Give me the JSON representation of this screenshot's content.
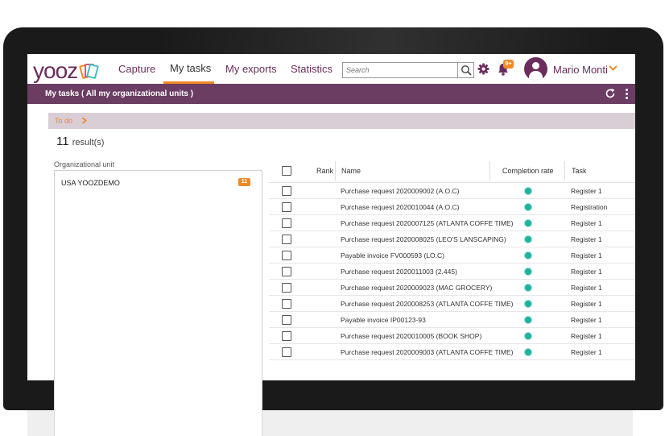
{
  "app": {
    "logo_text": "yooz",
    "brand_color": "#6b2d5c",
    "accent_color": "#f08a24",
    "status_color": "#20b2a0"
  },
  "nav": {
    "items": [
      {
        "label": "Capture",
        "active": false
      },
      {
        "label": "My tasks",
        "active": true
      },
      {
        "label": "My exports",
        "active": false
      },
      {
        "label": "Statistics",
        "active": false
      }
    ],
    "search_placeholder": "Search",
    "notification_badge": "9+",
    "user_name": "Mario Monti"
  },
  "page": {
    "title": "My tasks ( All my organizational units )",
    "section_label": "To do",
    "results_count": "11",
    "results_label": "result(s)"
  },
  "org_units": {
    "label": "Organizational unit",
    "items": [
      {
        "name": "USA YOOZDEMO",
        "count": "11"
      }
    ]
  },
  "table": {
    "columns": [
      "Rank",
      "Name",
      "Completion rate",
      "Task"
    ],
    "rows": [
      {
        "name": "Purchase request 2020009002 (A.O.C)",
        "task": "Register 1",
        "completion_icon": "status-dot"
      },
      {
        "name": "Purchase request 2020010044 (A.O.C)",
        "task": "Registration",
        "completion_icon": "status-dot"
      },
      {
        "name": "Purchase request 2020007125 (ATLANTA COFFE TIME)",
        "task": "Register 1",
        "completion_icon": "status-dot"
      },
      {
        "name": "Purchase request 2020008025 (LEO'S LANSCAPING)",
        "task": "Register 1",
        "completion_icon": "status-dot"
      },
      {
        "name": "Payable invoice FV000593 (LO.C)",
        "task": "Register 1",
        "completion_icon": "status-dot"
      },
      {
        "name": "Purchase request 2020011003 (2.445)",
        "task": "Register 1",
        "completion_icon": "status-dot"
      },
      {
        "name": "Purchase request 2020009023 (MAC GROCERY)",
        "task": "Register 1",
        "completion_icon": "status-dot"
      },
      {
        "name": "Purchase request 2020008253 (ATLANTA COFFE TIME)",
        "task": "Register 1",
        "completion_icon": "status-dot"
      },
      {
        "name": "Payable invoice IP00123-93",
        "task": "Register 1",
        "completion_icon": "status-dot"
      },
      {
        "name": "Purchase request 2020010005 (BOOK SHOP)",
        "task": "Register 1",
        "completion_icon": "status-dot"
      },
      {
        "name": "Purchase request 2020009003 (ATLANTA COFFE TIME)",
        "task": "Register 1",
        "completion_icon": "status-dot"
      }
    ]
  }
}
